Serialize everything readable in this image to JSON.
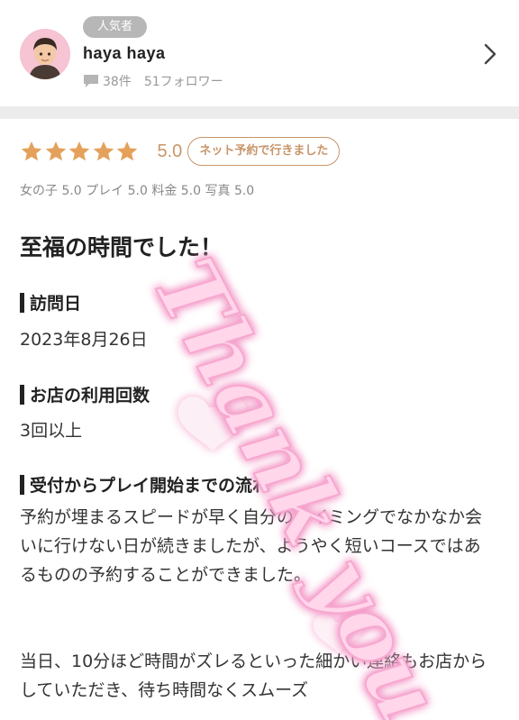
{
  "reviewer": {
    "badge": "人気者",
    "name": "haya haya",
    "review_count": "38件",
    "followers": "51フォロワー"
  },
  "rating": {
    "stars": 5,
    "score": "5.0",
    "net_badge": "ネット予約で行きました",
    "sub_ratings": "女の子 5.0  プレイ 5.0  料金 5.0  写真 5.0"
  },
  "review": {
    "title": "至福の時間でした！",
    "sections": {
      "visit_date": {
        "heading": "訪問日",
        "value": "2023年8月26日"
      },
      "usage_count": {
        "heading": "お店の利用回数",
        "value": "3回以上"
      },
      "flow": {
        "heading": "受付からプレイ開始までの流れ",
        "paragraph1": "予約が埋まるスピードが早く自分のタイミングでなかなか会いに行けない日が続きましたが、ようやく短いコースではあるものの予約することができました。",
        "paragraph2": "当日、10分ほど時間がズレるといった細かい連絡もお店からしていただき、待ち時間なくスムーズ"
      }
    }
  },
  "overlay": {
    "stamp_text": "Thank you"
  },
  "colors": {
    "star": "#e5a15a",
    "score": "#c8956a",
    "badge_bg": "#b7b7b7",
    "divider": "#ececec",
    "stamp_fill": "#ffd6ea",
    "stamp_glow": "#f39ac8"
  },
  "icons": {
    "comment": "comment-icon",
    "chevron": "chevron-right-icon",
    "star": "star-icon",
    "heart": "heart-icon"
  }
}
